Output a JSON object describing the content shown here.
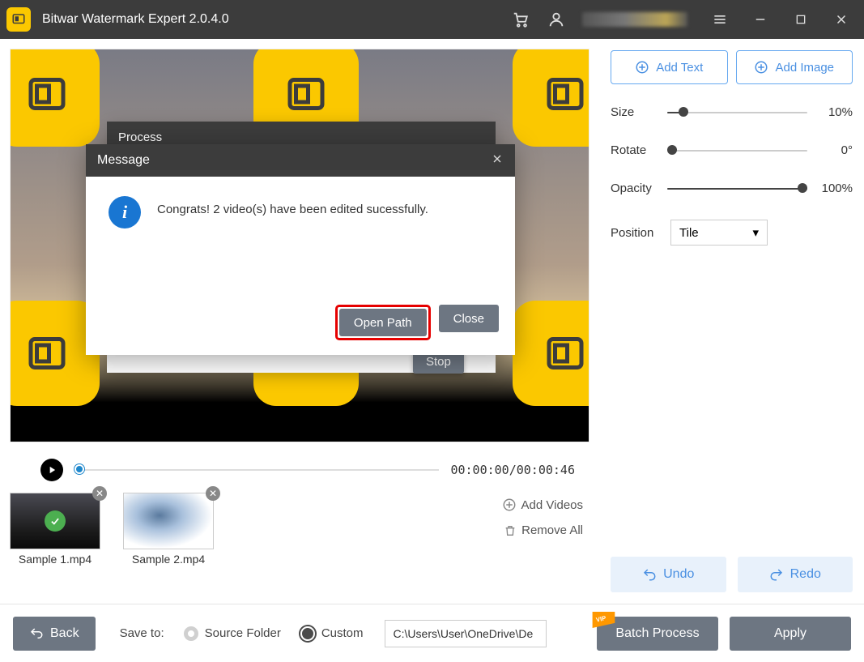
{
  "titlebar": {
    "app_title": "Bitwar Watermark Expert  2.0.4.0"
  },
  "right_panel": {
    "add_text": "Add Text",
    "add_image": "Add Image",
    "size": {
      "label": "Size",
      "value": "10%",
      "percent": 10
    },
    "rotate": {
      "label": "Rotate",
      "value": "0°",
      "percent": 0
    },
    "opacity": {
      "label": "Opacity",
      "value": "100%",
      "percent": 100
    },
    "position": {
      "label": "Position",
      "selected": "Tile"
    },
    "undo": "Undo",
    "redo": "Redo"
  },
  "player": {
    "time": "00:00:00/00:00:46"
  },
  "thumbs": {
    "items": [
      {
        "label": "Sample 1.mp4"
      },
      {
        "label": "Sample 2.mp4"
      }
    ],
    "add_videos": "Add Videos",
    "remove_all": "Remove All"
  },
  "bottom": {
    "back": "Back",
    "save_to": "Save to:",
    "source_folder": "Source Folder",
    "custom": "Custom",
    "path": "C:\\Users\\User\\OneDrive\\De",
    "batch": "Batch Process",
    "apply": "Apply"
  },
  "back_dialog": {
    "title": "Process",
    "stop": "Stop"
  },
  "dialog": {
    "title": "Message",
    "message": "Congrats! 2 video(s) have been edited sucessfully.",
    "open_path": "Open Path",
    "close": "Close"
  }
}
